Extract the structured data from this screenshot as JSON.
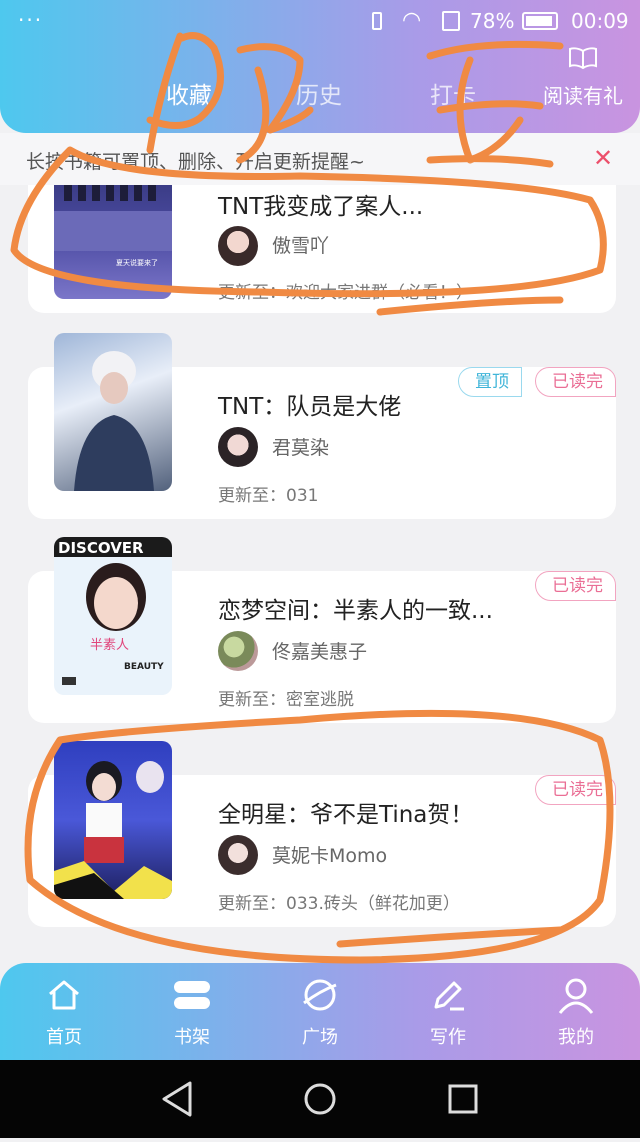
{
  "status": {
    "battery": "78%",
    "time": "00:09",
    "dots": "···"
  },
  "tabs": [
    {
      "label": "收藏"
    },
    {
      "label": "历史"
    },
    {
      "label": "打卡"
    }
  ],
  "gift": {
    "label": "阅读有礼"
  },
  "tip": {
    "text": "长按书籍可置顶、删除、开启更新提醒~",
    "close": "✕"
  },
  "books": [
    {
      "title": "TNT我变成了案人...",
      "author": "傲雪吖",
      "update": "更新至：欢迎大家进群（必看！）",
      "badges": []
    },
    {
      "title": "TNT：队员是大佬",
      "author": "君莫染",
      "update": "更新至：031",
      "badges": [
        "置顶",
        "已读完"
      ]
    },
    {
      "title": "恋梦空间：半素人的一致...",
      "author": "佟嘉美惠子",
      "update": "更新至：密室逃脱",
      "badges": [
        "已读完"
      ]
    },
    {
      "title": "全明星：爷不是Tina贺！",
      "author": "莫妮卡Momo",
      "update": "更新至：033.砖头（鲜花加更）",
      "badges": [
        "已读完"
      ]
    }
  ],
  "covers": [
    {
      "text": "夏天说要来了"
    },
    {
      "text": ""
    },
    {
      "line1": "DISCOVER",
      "line2": "半素人",
      "line3": "BEAUTY"
    },
    {
      "text": ""
    }
  ],
  "nav": [
    {
      "label": "首页",
      "icon": "home-icon"
    },
    {
      "label": "书架",
      "icon": "bookshelf-icon"
    },
    {
      "label": "广场",
      "icon": "planet-icon"
    },
    {
      "label": "写作",
      "icon": "pen-icon"
    },
    {
      "label": "我的",
      "icon": "user-icon"
    }
  ],
  "colors": {
    "accent_blue": "#4ec8ee",
    "accent_purple": "#c994e0",
    "read_badge": "#ea6e95",
    "pin_badge": "#3fb5d9",
    "scribble": "#f08a43"
  }
}
